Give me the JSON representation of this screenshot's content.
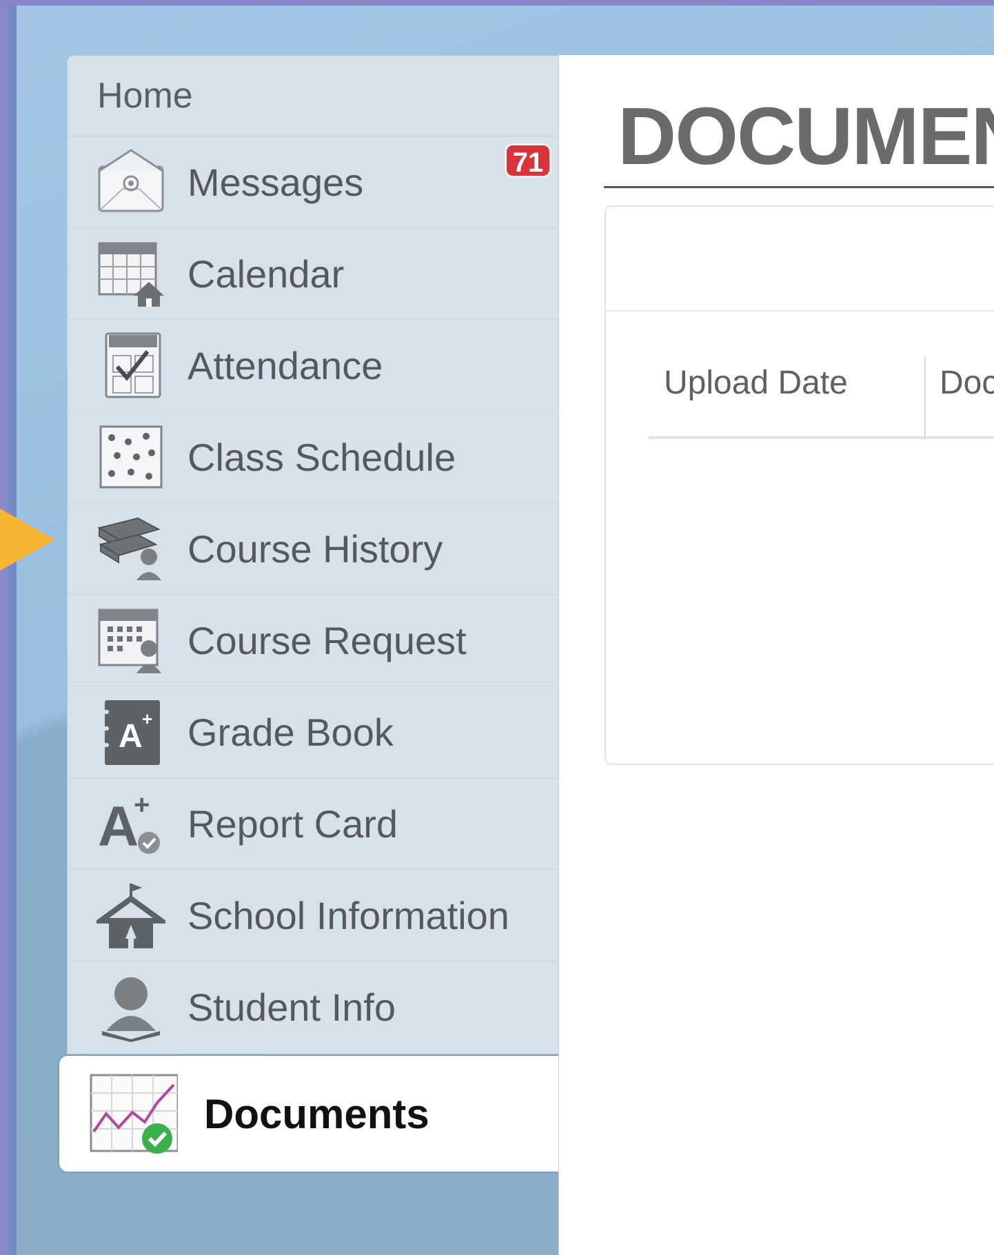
{
  "sidebar": {
    "home_label": "Home",
    "items": [
      {
        "label": "Messages",
        "icon": "envelope-icon",
        "badge": "71"
      },
      {
        "label": "Calendar",
        "icon": "calendar-icon"
      },
      {
        "label": "Attendance",
        "icon": "attendance-check-icon"
      },
      {
        "label": "Class Schedule",
        "icon": "schedule-grid-icon"
      },
      {
        "label": "Course History",
        "icon": "books-icon"
      },
      {
        "label": "Course Request",
        "icon": "course-request-icon"
      },
      {
        "label": "Grade Book",
        "icon": "gradebook-icon"
      },
      {
        "label": "Report Card",
        "icon": "report-card-icon"
      },
      {
        "label": "School Information",
        "icon": "school-icon"
      },
      {
        "label": "Student Info",
        "icon": "student-icon"
      }
    ],
    "active": {
      "label": "Documents",
      "icon": "documents-chart-icon"
    }
  },
  "main": {
    "title": "DOCUMEN",
    "table": {
      "columns": [
        "Upload Date",
        "Doc"
      ]
    }
  },
  "colors": {
    "accent_arrow": "#f4b633",
    "badge": "#d9343a",
    "sidebar_bg": "#d7e1ea",
    "check_green": "#3cae4a"
  }
}
